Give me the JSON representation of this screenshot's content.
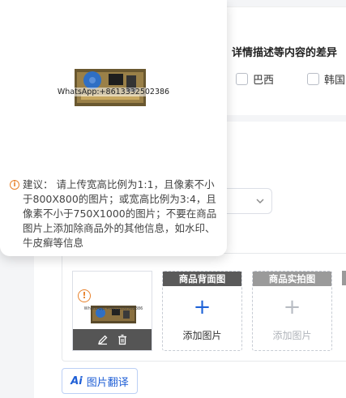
{
  "details": {
    "title": "详情描述等内容的差异",
    "countries": [
      {
        "label": "巴西",
        "checked": false
      },
      {
        "label": "韩国",
        "checked": false
      }
    ]
  },
  "popover": {
    "watermark": "WhatsApp:+8613332502386",
    "tip": "建议： 请上传宽高比例为1:1，且像素不小于800X800的图片；或宽高比例为3:4，且像素不小于750X1000的图片；不要在商品图片上添加除商品外的其他信息，如水印、牛皮癣等信息"
  },
  "upload": {
    "thumb_watermark": "WhatsApp:+8613332502386",
    "warning_mark": "!",
    "slots": [
      {
        "header": "商品背面图",
        "add_label": "添加图片",
        "active": true
      },
      {
        "header": "商品实拍图",
        "add_label": "添加图片",
        "active": false
      }
    ],
    "plus": "+"
  },
  "translate_button": {
    "ai": "Ai",
    "label": "图片翻译"
  },
  "colors": {
    "accent": "#1f5fd6",
    "warning": "#e8822c"
  },
  "icons": [
    "info-icon",
    "warning-icon",
    "edit-icon",
    "delete-icon",
    "chevron-down-icon",
    "ai-icon",
    "plus-icon"
  ]
}
